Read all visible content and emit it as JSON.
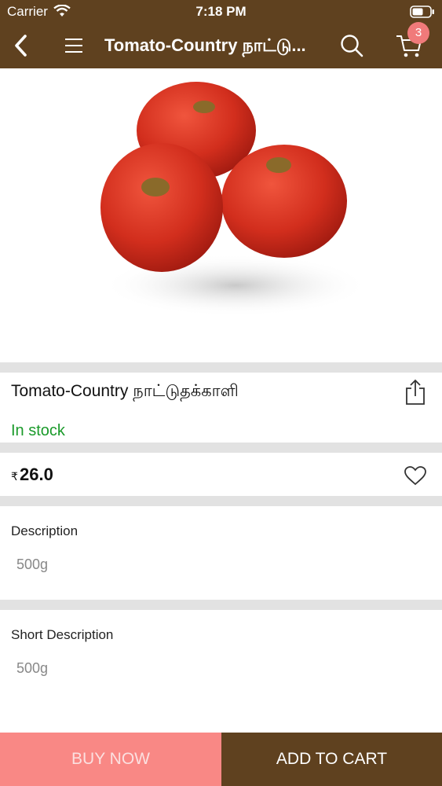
{
  "status_bar": {
    "carrier": "Carrier",
    "time": "7:18 PM"
  },
  "navbar": {
    "title": "Tomato-Country நாட்டு...",
    "back_icon": "chevron-left-icon",
    "menu_icon": "hamburger-icon",
    "search_icon": "search-icon",
    "cart_icon": "cart-icon",
    "cart_count": "3"
  },
  "product": {
    "name": "Tomato-Country நாட்டுதக்காளி",
    "stock_status": "In stock",
    "currency": "₹",
    "price": "26.0"
  },
  "description": {
    "title": "Description",
    "value": "500g"
  },
  "short_description": {
    "title": "Short Description",
    "value": "500g"
  },
  "actions": {
    "buy_now": "BUY NOW",
    "add_to_cart": "ADD TO CART"
  },
  "colors": {
    "header": "#5f411f",
    "buy_now": "#f98885",
    "in_stock": "#1a9a2a",
    "badge": "#f07a7a"
  }
}
